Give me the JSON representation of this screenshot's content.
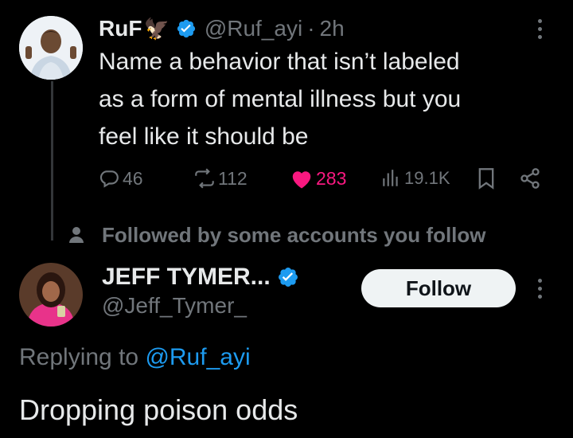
{
  "tweet": {
    "author_name": "RuF",
    "author_name_emoji": "🦅",
    "author_handle": "@Ruf_ayi",
    "separator": "·",
    "time": "2h",
    "text_lines": [
      "Name a behavior that isn’t labeled",
      "as a form of mental illness but you",
      "feel like it should be"
    ],
    "metrics": {
      "replies": "46",
      "retweets": "112",
      "likes": "283",
      "views": "19.1K"
    }
  },
  "context": {
    "followed_by": "Followed by some accounts you follow"
  },
  "reply": {
    "author_name": "JEFF TYMER...",
    "author_handle": "@Jeff_Tymer_",
    "follow_label": "Follow",
    "replying_prefix": "Replying to",
    "replying_handle": "@Ruf_ayi",
    "text": "Dropping poison odds"
  },
  "colors": {
    "background": "#000000",
    "text": "#e7e9ea",
    "muted": "#71767b",
    "verified": "#1d9bf0",
    "like": "#f91880",
    "link": "#1d9bf0"
  },
  "icons": {
    "reply": "speech-bubble-icon",
    "retweet": "retweet-icon",
    "like": "heart-icon",
    "views": "bar-chart-icon",
    "bookmark": "bookmark-icon",
    "share": "share-icon",
    "more": "more-dots-icon",
    "verified": "verified-badge-icon",
    "person": "person-icon"
  }
}
